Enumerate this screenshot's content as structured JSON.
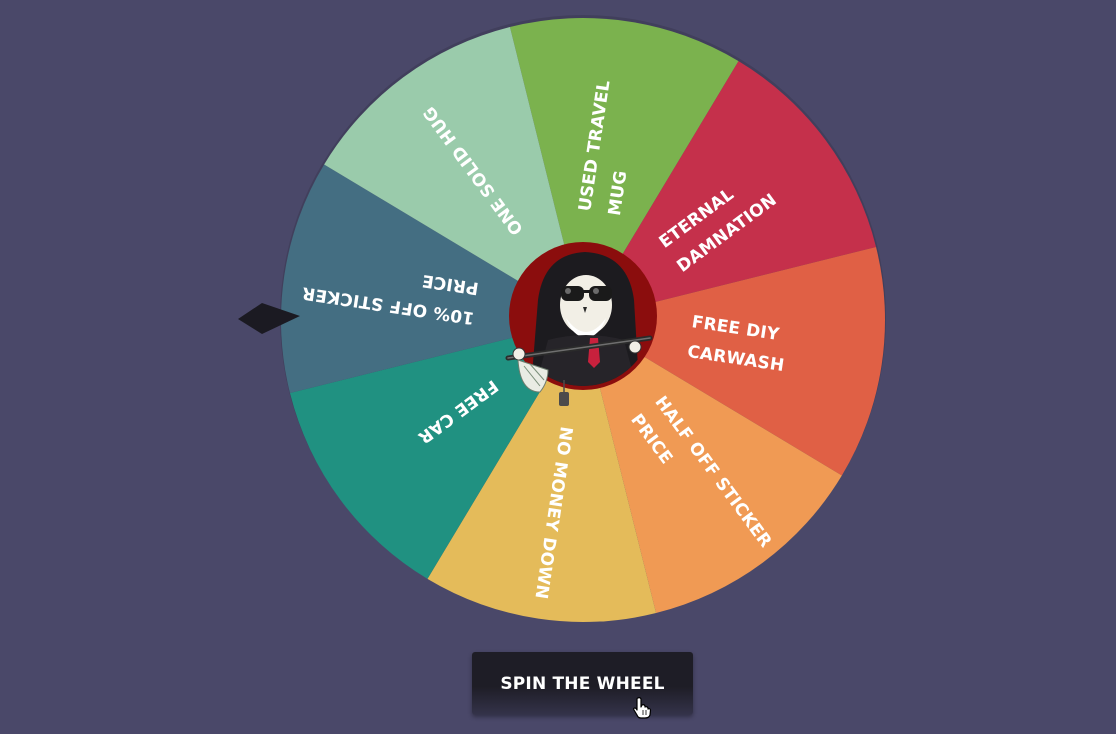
{
  "wheel": {
    "segments": [
      {
        "label": [
          "USED TRAVEL",
          "MUG"
        ],
        "color": "#7bb24e"
      },
      {
        "label": [
          "ETERNAL",
          "DAMNATION"
        ],
        "color": "#c5304b"
      },
      {
        "label": [
          "FREE DIY",
          "CARWASH"
        ],
        "color": "#e06045"
      },
      {
        "label": [
          "HALF OFF STICKER",
          "PRICE"
        ],
        "color": "#f09a54"
      },
      {
        "label": [
          "NO MONEY DOWN"
        ],
        "color": "#e4bb5a"
      },
      {
        "label": [
          "FREE CAR"
        ],
        "color": "#209181"
      },
      {
        "label": [
          "10% OFF STICKER",
          "PRICE"
        ],
        "color": "#446e82"
      },
      {
        "label": [
          "ONE SOLID HUG"
        ],
        "color": "#9acbab"
      }
    ],
    "pointer_color": "#1b1a22",
    "hub_color": "#8b0d0d"
  },
  "spin_button": {
    "label": "SPIN THE WHEEL"
  }
}
